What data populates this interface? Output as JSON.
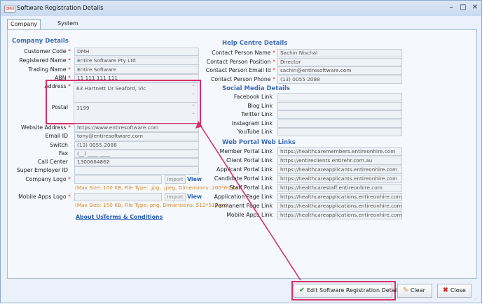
{
  "window": {
    "title": "Software Registration Details",
    "icon_text": "DMH",
    "min": "–",
    "max": "□",
    "close": "✕"
  },
  "tabs": [
    {
      "label": "Company Details",
      "active": true
    },
    {
      "label": "System Settings",
      "active": false
    }
  ],
  "company": {
    "heading": "Company Details",
    "customer_code": {
      "label": "Customer Code",
      "value": "DMH"
    },
    "registered_name": {
      "label": "Registered Name",
      "value": "Entire Software Pty Ltd"
    },
    "trading_name": {
      "label": "Trading Name",
      "value": "Entire Software"
    },
    "abn": {
      "label": "ABN",
      "value": "11 111 111 111"
    },
    "address": {
      "label": "Address",
      "value": "63 Hartnett Dr Seaford, Vic"
    },
    "postal": {
      "label": "Postal",
      "value": "3199"
    },
    "website": {
      "label": "Website Address",
      "value": "https://www.entiresoftware.com"
    },
    "email": {
      "label": "Email ID",
      "value": "tony@entiresoftware.com"
    },
    "switch": {
      "label": "Switch",
      "value": "(13) 0055 2088"
    },
    "fax": {
      "label": "Fax",
      "value": "(__) ____ ____"
    },
    "call_center": {
      "label": "Call Center",
      "value": "1300664862"
    },
    "super_employer": {
      "label": "Super Employer ID",
      "value": ""
    },
    "company_logo": {
      "label": "Company Logo",
      "import": "Import",
      "view": "View",
      "hint": "(Max Size: 100 KB, File Type: .jpg, .jpeg, Dimensions: 200*60 px)"
    },
    "mobile_logo": {
      "label": "Mobile Apps Logo",
      "import": "Import",
      "view": "View",
      "hint": "(Max Size: 150 KB, File Type: png, Dimensions: 512*512 px)"
    },
    "about_us": "About Us",
    "terms": "Terms & Conditions",
    "required_mark": "*"
  },
  "help": {
    "heading": "Help Centre Details",
    "contact_name": {
      "label": "Contact Person Name",
      "value": "Sachin Nischal"
    },
    "contact_position": {
      "label": "Contact Person Position",
      "value": "Director"
    },
    "contact_email": {
      "label": "Contact Person Email Id",
      "value": "sachin@entiresoftware.com"
    },
    "contact_phone": {
      "label": "Contact Person Phone",
      "value": "(13) 0055 2088"
    }
  },
  "social": {
    "heading": "Social Media Details",
    "facebook": {
      "label": "Facebook Link",
      "value": ""
    },
    "blog": {
      "label": "Blog Link",
      "value": ""
    },
    "twitter": {
      "label": "Twitter Link",
      "value": ""
    },
    "instagram": {
      "label": "Instagram Link",
      "value": ""
    },
    "youtube": {
      "label": "YouTube Link",
      "value": ""
    }
  },
  "portal": {
    "heading": "Web Portal Web Links",
    "member": {
      "label": "Member Portal Link",
      "value": "https://healthcaremembers.entireonhire.com"
    },
    "client": {
      "label": "Client Portal Link",
      "value": "https://entireclients.entirehr.com.au"
    },
    "applicant": {
      "label": "Applicant Portal Link",
      "value": "https://healthcareapplicants.entireonhire.com"
    },
    "candidate": {
      "label": "Candidate Portal Link",
      "value": "https://healthcareapplicants.entireonhire.com"
    },
    "staff": {
      "label": "Staff Portal Link",
      "value": "https://healthcarestaff.entireonhire.com"
    },
    "application_page": {
      "label": "Application Page Link",
      "value": "https://healthcareapplications.entireonhire.com"
    },
    "permanent_page": {
      "label": "Permanent Page Link",
      "value": "https://healthcareapplications.entireonhire.com/Perma"
    },
    "mobile_apps": {
      "label": "Mobile Apps Link",
      "value": "https://healthcareapplications.entireonhire.com/mobile"
    }
  },
  "buttons": {
    "edit": "Edit Software Registration Details",
    "clear": "Clear",
    "close": "Close"
  },
  "colors": {
    "accent": "#3d6eb6",
    "highlight": "#d9306a",
    "hint": "#d58a2a"
  }
}
